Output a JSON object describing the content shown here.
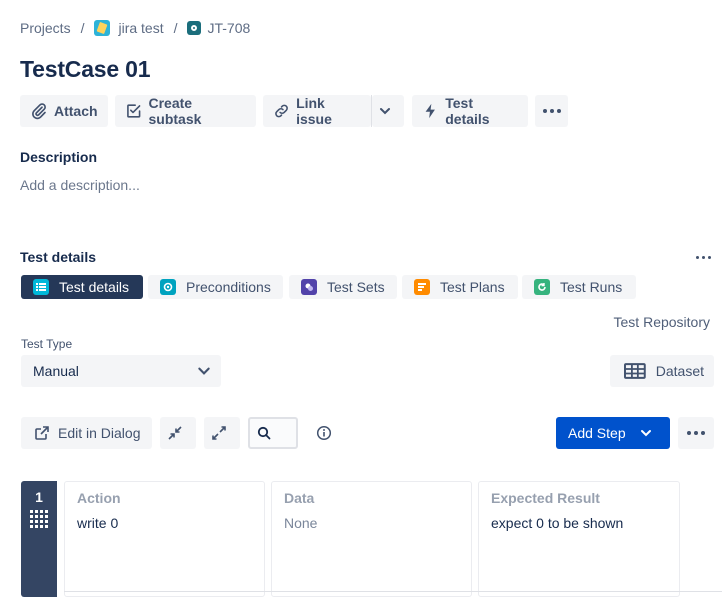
{
  "breadcrumb": {
    "projects": "Projects",
    "project": "jira test",
    "issue_key": "JT-708"
  },
  "issue": {
    "title": "TestCase 01"
  },
  "actions": {
    "attach": "Attach",
    "create_subtask": "Create subtask",
    "link_issue": "Link issue",
    "test_details": "Test details"
  },
  "description": {
    "label": "Description",
    "placeholder": "Add a description..."
  },
  "test_details": {
    "label": "Test details",
    "tabs": [
      {
        "label": "Test details",
        "icon": "list-icon",
        "color": "#00b8d9"
      },
      {
        "label": "Preconditions",
        "icon": "precondition-icon",
        "color": "#00a3bf"
      },
      {
        "label": "Test Sets",
        "icon": "test-sets-icon",
        "color": "#5243aa"
      },
      {
        "label": "Test Plans",
        "icon": "test-plans-icon",
        "color": "#ff8b00"
      },
      {
        "label": "Test Runs",
        "icon": "test-runs-icon",
        "color": "#36b37e"
      }
    ],
    "repository_link": "Test Repository",
    "test_type_label": "Test Type",
    "test_type_value": "Manual",
    "dataset_button": "Dataset"
  },
  "steps_toolbar": {
    "edit_in_dialog": "Edit in Dialog",
    "add_step": "Add Step"
  },
  "steps": {
    "columns": [
      "Action",
      "Data",
      "Expected Result"
    ],
    "rows": [
      {
        "index": "1",
        "action": "write 0",
        "data": "None",
        "expected": "expect 0 to be shown"
      }
    ]
  },
  "colors": {
    "primary": "#0052cc",
    "dark": "#253858",
    "button_bg": "#f4f5f7"
  }
}
